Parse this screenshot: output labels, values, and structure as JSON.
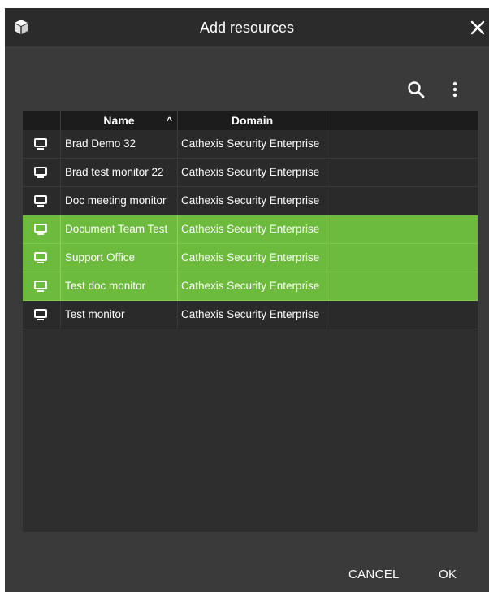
{
  "dialog": {
    "title": "Add resources",
    "app_icon": "cube-icon",
    "close_icon": "close-icon"
  },
  "toolbar": {
    "search_icon": "search-icon",
    "more_icon": "more-vertical-icon"
  },
  "table": {
    "columns": [
      {
        "label": ""
      },
      {
        "label": "Name",
        "sort": "ascending"
      },
      {
        "label": "Domain"
      },
      {
        "label": ""
      }
    ],
    "sort_indicator": "^",
    "row_icon": "monitor-icon",
    "rows": [
      {
        "name": "Brad Demo 32",
        "domain": "Cathexis Security Enterprise",
        "selected": false
      },
      {
        "name": "Brad test monitor 22",
        "domain": "Cathexis Security Enterprise",
        "selected": false
      },
      {
        "name": "Doc meeting monitor",
        "domain": "Cathexis Security Enterprise",
        "selected": false
      },
      {
        "name": "Document Team Test",
        "domain": "Cathexis Security Enterprise",
        "selected": true
      },
      {
        "name": "Support Office",
        "domain": "Cathexis Security Enterprise",
        "selected": true
      },
      {
        "name": "Test doc monitor",
        "domain": "Cathexis Security Enterprise",
        "selected": true
      },
      {
        "name": "Test monitor",
        "domain": "Cathexis Security Enterprise",
        "selected": false
      }
    ]
  },
  "footer": {
    "cancel_label": "CANCEL",
    "ok_label": "OK"
  },
  "colors": {
    "selection": "#6dbb3c",
    "background": "#3a3a3a",
    "titlebar": "#2b2b2b",
    "header": "#1c1c1c"
  }
}
